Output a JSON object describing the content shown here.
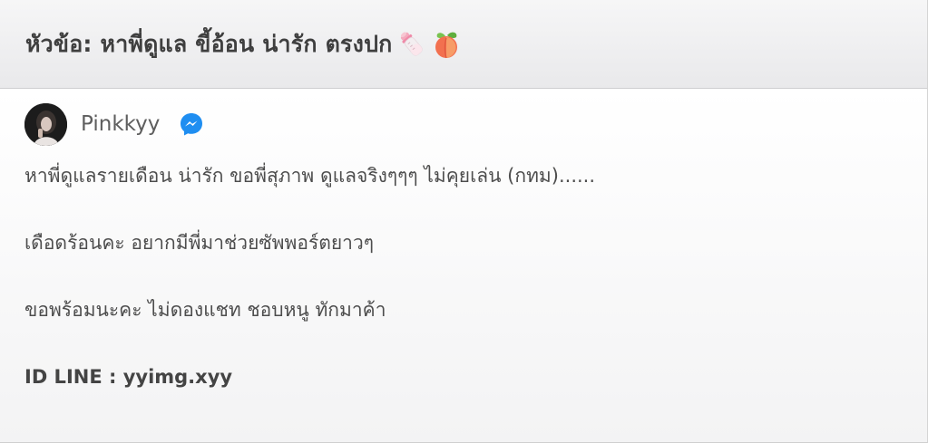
{
  "topic": {
    "title": "หัวข้อ: หาพี่ดูแล ขี้อ้อน น่ารัก ตรงปก",
    "emojis": [
      "baby-bottle-emoji",
      "peach-emoji"
    ]
  },
  "post": {
    "author": {
      "name": "Pinkkyy",
      "avatar_icon": "avatar-photo",
      "contact_icon": "messenger-icon",
      "contact_icon_color": "#1f8ef1"
    },
    "lines": [
      "หาพี่ดูแลรายเดือน น่ารัก ขอพี่สุภาพ  ดูแลจริงๆๆๆ ไม่คุยเล่น (กทม)......",
      "เดือดร้อนคะ อยากมีพี่มาช่วยซัพพอร์ตยาวๆ",
      "ขอพร้อมนะคะ ไม่ดองแชท ชอบหนู ทักมาค้า",
      "ID LINE : yyimg.xyy"
    ]
  }
}
